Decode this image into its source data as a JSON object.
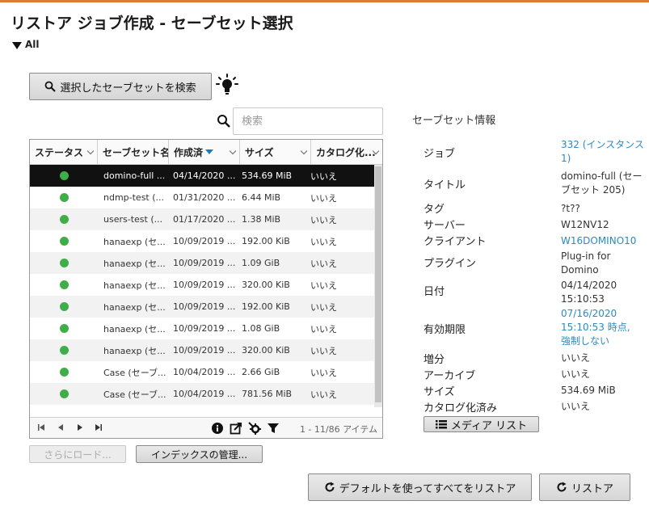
{
  "page": {
    "title": "リストア ジョブ作成 - セーブセット選択",
    "filter_label": "All",
    "accent_color": "#e07a2e",
    "link_color": "#2a8bc4",
    "status_ok_color": "#3fae49"
  },
  "toolbar": {
    "search_saveset_button": "選択したセーブセットを検索",
    "search_placeholder": "検索"
  },
  "table": {
    "columns": [
      "ステータス",
      "セーブセット名",
      "作成済",
      "サイズ",
      "カタログ化..."
    ],
    "sort_column": "作成済",
    "rows": [
      {
        "status": "ok",
        "name": "domino-full ...",
        "created": "04/14/2020 ...",
        "size": "534.69 MiB",
        "cataloged": "いいえ",
        "selected": true
      },
      {
        "status": "ok",
        "name": "ndmp-test (...",
        "created": "01/31/2020 ...",
        "size": "6.44 MiB",
        "cataloged": "いいえ"
      },
      {
        "status": "ok",
        "name": "users-test (...",
        "created": "01/17/2020 ...",
        "size": "1.38 MiB",
        "cataloged": "いいえ"
      },
      {
        "status": "ok",
        "name": "hanaexp (セ...",
        "created": "10/09/2019 ...",
        "size": "192.00 KiB",
        "cataloged": "いいえ"
      },
      {
        "status": "ok",
        "name": "hanaexp (セ...",
        "created": "10/09/2019 ...",
        "size": "1.09 GiB",
        "cataloged": "いいえ"
      },
      {
        "status": "ok",
        "name": "hanaexp (セ...",
        "created": "10/09/2019 ...",
        "size": "320.00 KiB",
        "cataloged": "いいえ"
      },
      {
        "status": "ok",
        "name": "hanaexp (セ...",
        "created": "10/09/2019 ...",
        "size": "192.00 KiB",
        "cataloged": "いいえ"
      },
      {
        "status": "ok",
        "name": "hanaexp (セ...",
        "created": "10/09/2019 ...",
        "size": "1.08 GiB",
        "cataloged": "いいえ"
      },
      {
        "status": "ok",
        "name": "hanaexp (セ...",
        "created": "10/09/2019 ...",
        "size": "320.00 KiB",
        "cataloged": "いいえ"
      },
      {
        "status": "ok",
        "name": "Case (セーブ...",
        "created": "10/04/2019 ...",
        "size": "2.66 GiB",
        "cataloged": "いいえ"
      },
      {
        "status": "ok",
        "name": "Case (セーブ...",
        "created": "10/04/2019 ...",
        "size": "781.56 MiB",
        "cataloged": "いいえ"
      }
    ],
    "item_count": "1 - 11/86 アイテム"
  },
  "actions": {
    "load_more": "さらにロード...",
    "manage_index": "インデックスの管理...",
    "restore_all_default": "デフォルトを使ってすべてをリストア",
    "restore": "リストア"
  },
  "info": {
    "title": "セーブセット情報",
    "labels": {
      "job": "ジョブ",
      "title": "タイトル",
      "tag": "タグ",
      "server": "サーバー",
      "client": "クライアント",
      "plugin": "プラグイン",
      "date": "日付",
      "expiry": "有効期限",
      "incremental": "増分",
      "archive": "アーカイブ",
      "size": "サイズ",
      "cataloged": "カタログ化済み"
    },
    "values": {
      "job": "332 (インスタンス 1)",
      "title": "domino-full (セーブセット 205)",
      "tag": "?t??",
      "server": "W12NV12",
      "client": "W16DOMINO10",
      "plugin": "Plug-in for Domino",
      "date": "04/14/2020 15:10:53",
      "expiry": "07/16/2020 15:10:53 時点, 強制しない",
      "incremental": "いいえ",
      "archive": "いいえ",
      "size": "534.69 MiB",
      "cataloged": "いいえ"
    },
    "media_list_button": "メディア リスト"
  }
}
